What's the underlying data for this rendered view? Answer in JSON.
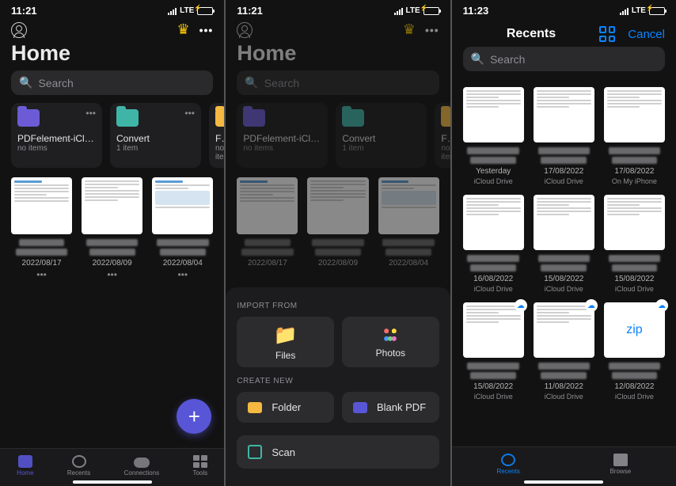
{
  "status": {
    "time_a": "11:21",
    "time_b": "11:21",
    "time_c": "11:23",
    "net": "LTE"
  },
  "home": {
    "title": "Home",
    "search_placeholder": "Search",
    "folders": [
      {
        "name": "PDFelement-iCloud",
        "sub": "no items",
        "color": "purple"
      },
      {
        "name": "Convert",
        "sub": "1 item",
        "color": "teal"
      },
      {
        "name": "Favorit",
        "sub": "no items",
        "color": "yellow"
      }
    ],
    "docs": [
      {
        "date": "2022/08/17"
      },
      {
        "date": "2022/08/09"
      },
      {
        "date": "2022/08/04"
      }
    ]
  },
  "sheet": {
    "import_label": "IMPORT FROM",
    "create_label": "CREATE NEW",
    "files": "Files",
    "photos": "Photos",
    "folder": "Folder",
    "blank_pdf": "Blank PDF",
    "scan": "Scan"
  },
  "tabs": {
    "home": "Home",
    "recents": "Recents",
    "connections": "Connections",
    "tools": "Tools"
  },
  "picker": {
    "title": "Recents",
    "cancel": "Cancel",
    "search_placeholder": "Search",
    "items": [
      {
        "date": "Yesterday",
        "loc": "iCloud Drive",
        "thumb": "doc"
      },
      {
        "date": "17/08/2022",
        "loc": "iCloud Drive",
        "thumb": "doc"
      },
      {
        "date": "17/08/2022",
        "loc": "On My iPhone",
        "thumb": "doc"
      },
      {
        "date": "16/08/2022",
        "loc": "iCloud Drive",
        "thumb": "doc"
      },
      {
        "date": "15/08/2022",
        "loc": "iCloud Drive",
        "thumb": "doc"
      },
      {
        "date": "15/08/2022",
        "loc": "iCloud Drive",
        "thumb": "doc"
      },
      {
        "date": "15/08/2022",
        "loc": "iCloud Drive",
        "thumb": "doc"
      },
      {
        "date": "11/08/2022",
        "loc": "iCloud Drive",
        "thumb": "doc"
      },
      {
        "date": "12/08/2022",
        "loc": "iCloud Drive",
        "thumb": "zip",
        "zip_label": "zip"
      }
    ],
    "tabbar": {
      "recents": "Recents",
      "browse": "Browse"
    }
  }
}
